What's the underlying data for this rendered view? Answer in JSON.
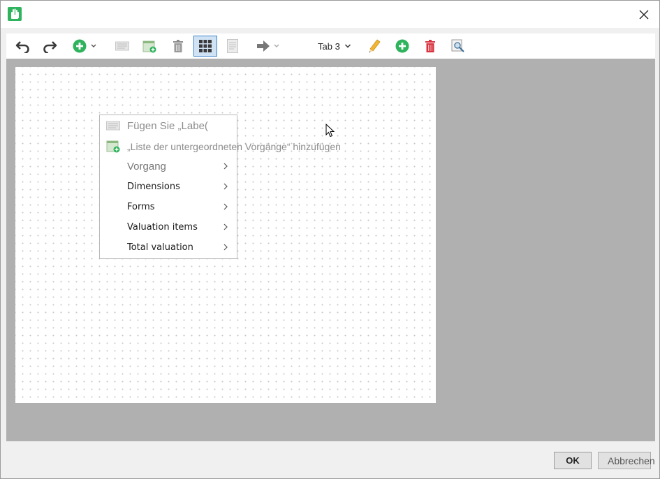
{
  "window": {
    "close_symbol": "✕"
  },
  "toolbar": {
    "items": [
      {
        "name": "undo-button",
        "icon": "undo-icon"
      },
      {
        "name": "redo-button",
        "icon": "redo-icon"
      },
      {
        "name": "add-dropdown-button",
        "icon": "add-green-icon"
      },
      {
        "name": "add-label-button",
        "icon": "label-icon"
      },
      {
        "name": "add-subtask-list-button",
        "icon": "calendar-add-icon"
      },
      {
        "name": "delete-button",
        "icon": "trash-icon"
      },
      {
        "name": "grid-toggle-button",
        "icon": "grid-icon",
        "selected": true
      },
      {
        "name": "page-button",
        "icon": "page-icon"
      },
      {
        "name": "move-dropdown-button",
        "icon": "arrow-right-icon"
      },
      {
        "name": "edit-tab-button",
        "icon": "pencil-icon"
      },
      {
        "name": "add-tab-button",
        "icon": "add-green-icon"
      },
      {
        "name": "delete-tab-button",
        "icon": "trash-red-icon"
      },
      {
        "name": "preview-button",
        "icon": "preview-icon"
      }
    ],
    "tab_select": {
      "value": "Tab 3"
    }
  },
  "context_menu": {
    "items": [
      {
        "label": "Fügen Sie „Labe(",
        "icon": "label-icon",
        "submenu": false
      },
      {
        "label": "„Liste der untergeordneten Vorgänge“ hinzufügen",
        "icon": "calendar-add-icon",
        "submenu": false
      },
      {
        "label": "Vorgang",
        "submenu": true
      },
      {
        "label": "Dimensions",
        "submenu": true
      },
      {
        "label": "Forms",
        "submenu": true
      },
      {
        "label": "Valuation items",
        "submenu": true
      },
      {
        "label": "Total valuation",
        "submenu": true
      }
    ]
  },
  "footer": {
    "ok_label": "OK",
    "cancel_label": "Abbrechen"
  },
  "colors": {
    "accent_green": "#2fb35c",
    "delete_red": "#d9333f",
    "selection_blue": "#3c83c8",
    "workspace_grey": "#b0b0b0"
  }
}
